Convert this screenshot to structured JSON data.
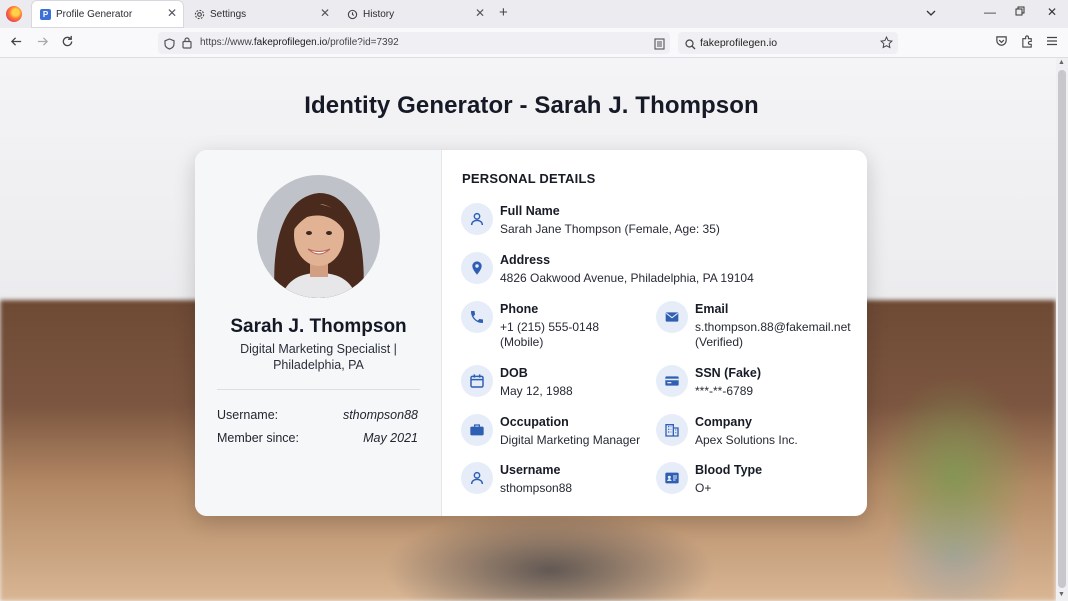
{
  "browser": {
    "tabs": [
      {
        "label": "Profile Generator",
        "active": true
      },
      {
        "label": "Settings",
        "active": false
      },
      {
        "label": "History",
        "active": false
      }
    ],
    "url": {
      "prefix": "https://www.",
      "host": "fakeprofilegen.io",
      "path": "/profile?id=7392"
    },
    "search_text": "fakeprofilegen.io"
  },
  "page": {
    "title": "Identity Generator - Sarah J. Thompson"
  },
  "profile": {
    "name": "Sarah J. Thompson",
    "title_line1": "Digital Marketing Specialist |",
    "title_line2": "Philadelphia, PA",
    "username_label": "Username:",
    "username_value": "sthompson88",
    "member_label": "Member since:",
    "member_value": "May 2021"
  },
  "details": {
    "section_title": "PERSONAL DETAILS",
    "full_name": {
      "label": "Full Name",
      "value": "Sarah Jane Thompson (Female, Age: 35)",
      "icon": "person-icon"
    },
    "address": {
      "label": "Address",
      "value": "4826 Oakwood Avenue, Philadelphia, PA 19104",
      "icon": "location-pin-icon"
    },
    "phone": {
      "label": "Phone",
      "value1": "+1 (215) 555-0148",
      "value2": "(Mobile)",
      "icon": "phone-icon"
    },
    "email": {
      "label": "Email",
      "value1": "s.thompson.88@fakemail.net",
      "value2": "(Verified)",
      "icon": "mail-icon"
    },
    "dob": {
      "label": "DOB",
      "value": "May 12, 1988",
      "icon": "calendar-icon"
    },
    "ssn": {
      "label": "SSN (Fake)",
      "value": "***-**-6789",
      "icon": "id-card-icon"
    },
    "occupation": {
      "label": "Occupation",
      "value": "Digital Marketing Manager",
      "icon": "briefcase-icon"
    },
    "company": {
      "label": "Company",
      "value": "Apex Solutions Inc.",
      "icon": "building-icon"
    },
    "username": {
      "label": "Username",
      "value": "sthompson88",
      "icon": "person-icon"
    },
    "blood_type": {
      "label": "Blood Type",
      "value": "O+",
      "icon": "badge-icon"
    }
  },
  "colors": {
    "accent": "#2f5fb3",
    "icon_bg": "#e6edf8",
    "card_bg": "#ffffff"
  }
}
